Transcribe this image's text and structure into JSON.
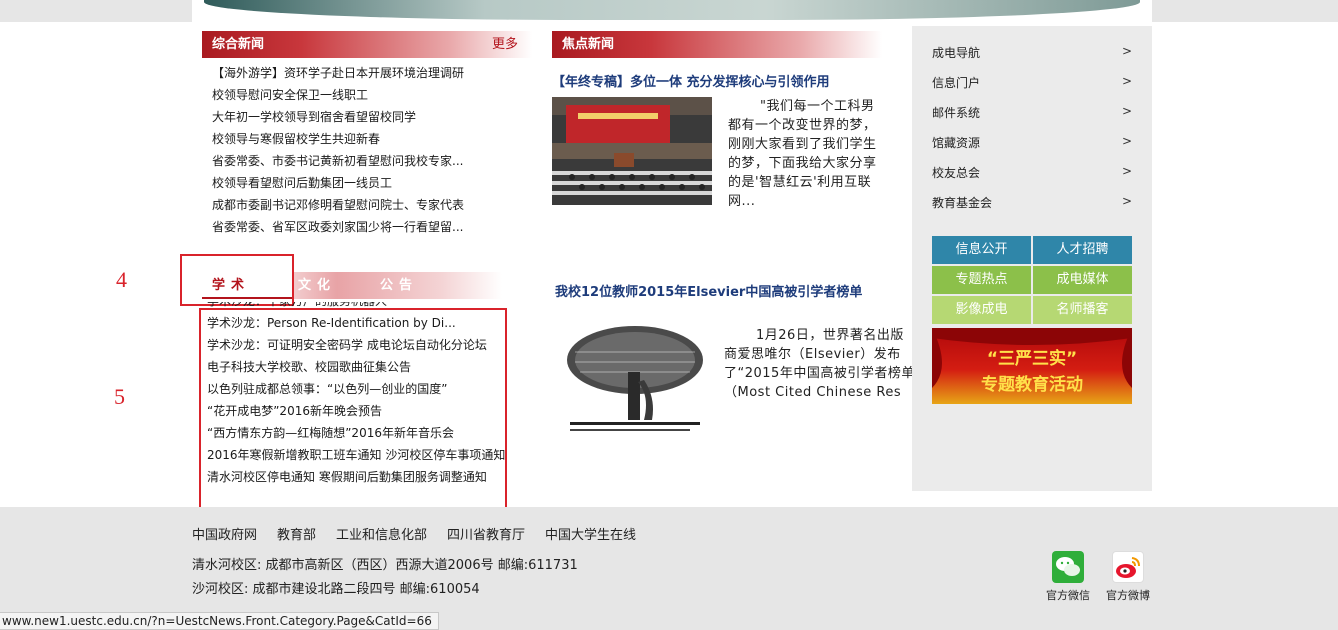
{
  "general_news": {
    "title": "综合新闻",
    "more": "更多",
    "items": [
      "【海外游学】资环学子赴日本开展环境治理调研",
      "校领导慰问安全保卫一线职工",
      "大年初一学校领导到宿舍看望留校同学",
      "校领导与寒假留校学生共迎新春",
      "省委常委、市委书记黄新初看望慰问我校专家...",
      "校领导看望慰问后勤集团一线员工",
      "成都市委副书记邓修明看望慰问院士、专家代表",
      "省委常委、省军区政委刘家国少将一行看望留..."
    ]
  },
  "focus_news": {
    "title": "焦点新闻",
    "headline": "【年终专稿】多位一体 充分发挥核心与引领作用",
    "summary": "\"我们每一个工科男都有一个改变世界的梦，刚刚大家看到了我们学生的梦，下面我给大家分享的是'智慧红云'利用互联网..."
  },
  "tabs": {
    "items": [
      "学术",
      "文化",
      "公告"
    ],
    "active": 0
  },
  "academic_list": [
    "学术沙龙：千家万户的服务机器人",
    "学术沙龙：Person Re-Identification by Di...",
    "学术沙龙：可证明安全密码学 成电论坛自动化分论坛",
    "电子科技大学校歌、校园歌曲征集公告",
    "以色列驻成都总领事：“以色列—创业的国度”",
    "“花开成电梦”2016新年晚会预告",
    "“西方情东方韵—红梅随想”2016年新年音乐会",
    "2016年寒假新增教职工班车通知 沙河校区停车事项通知",
    "清水河校区停电通知 寒假期间后勤集团服务调整通知"
  ],
  "annotations": {
    "tabs_number": "4",
    "list_number": "5"
  },
  "feature": {
    "headline": "我校12位教师2015年Elsevier中国高被引学者榜单",
    "summary": "1月26日，世界著名出版商爱思唯尔（Elsevier）发布了“2015年中国高被引学者榜单（Most Cited Chinese Res"
  },
  "sidebar": {
    "links": [
      "成电导航",
      "信息门户",
      "邮件系统",
      "馆藏资源",
      "校友总会",
      "教育基金会"
    ],
    "arrow": ">",
    "buttons": [
      {
        "label": "信息公开",
        "color": "#2f86a9"
      },
      {
        "label": "人才招聘",
        "color": "#2f86a9"
      },
      {
        "label": "专题热点",
        "color": "#8cc04a"
      },
      {
        "label": "成电媒体",
        "color": "#8cc04a"
      },
      {
        "label": "影像成电",
        "color": "#b6d873"
      },
      {
        "label": "名师播客",
        "color": "#b6d873"
      }
    ],
    "promo_line1": "“三严三实”",
    "promo_line2": "专题教育活动"
  },
  "footer": {
    "links": [
      "中国政府网",
      "教育部",
      "工业和信息化部",
      "四川省教育厅",
      "中国大学生在线"
    ],
    "address1": "清水河校区: 成都市高新区（西区）西源大道2006号 邮编:611731",
    "address2": "沙河校区: 成都市建设北路二段四号 邮编:610054",
    "wechat": "官方微信",
    "weibo": "官方微博"
  },
  "status_url": "www.new1.uestc.edu.cn/?n=UestcNews.Front.Category.Page&CatId=66",
  "colors": {
    "brand_red": "#b3141c",
    "annotation_red": "#d9232b",
    "link_blue": "#1e3c7b"
  }
}
